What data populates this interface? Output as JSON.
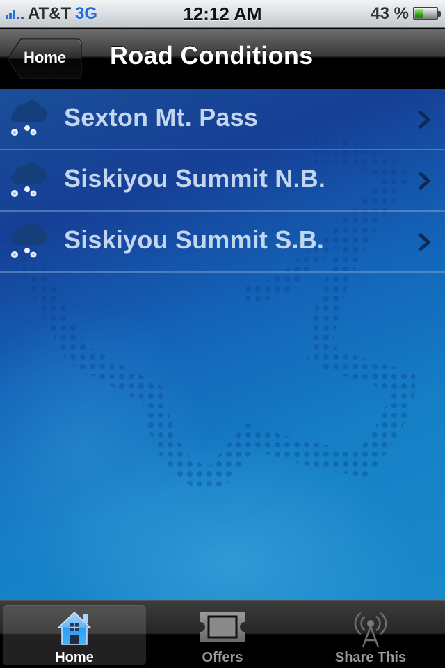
{
  "status_bar": {
    "carrier": "AT&T",
    "network": "3G",
    "time": "12:12 AM",
    "battery_percent_label": "43 %",
    "battery_level": 0.43,
    "signal_bars_active": 3,
    "signal_bars_total": 5
  },
  "nav_bar": {
    "back_label": "Home",
    "title": "Road Conditions"
  },
  "list": {
    "items": [
      {
        "label": "Sexton Mt. Pass",
        "icon": "snow-cloud-icon"
      },
      {
        "label": "Siskiyou Summit N.B.",
        "icon": "snow-cloud-icon"
      },
      {
        "label": "Siskiyou Summit S.B.",
        "icon": "snow-cloud-icon"
      }
    ]
  },
  "tab_bar": {
    "tabs": [
      {
        "label": "Home",
        "icon": "house-icon",
        "selected": true
      },
      {
        "label": "Offers",
        "icon": "ticket-icon",
        "selected": false
      },
      {
        "label": "Share This",
        "icon": "broadcast-tower-icon",
        "selected": false
      }
    ]
  },
  "colors": {
    "accent": "#1e6ce0",
    "list_text": "#c4d6ee",
    "battery_green": "#2aa51a"
  }
}
